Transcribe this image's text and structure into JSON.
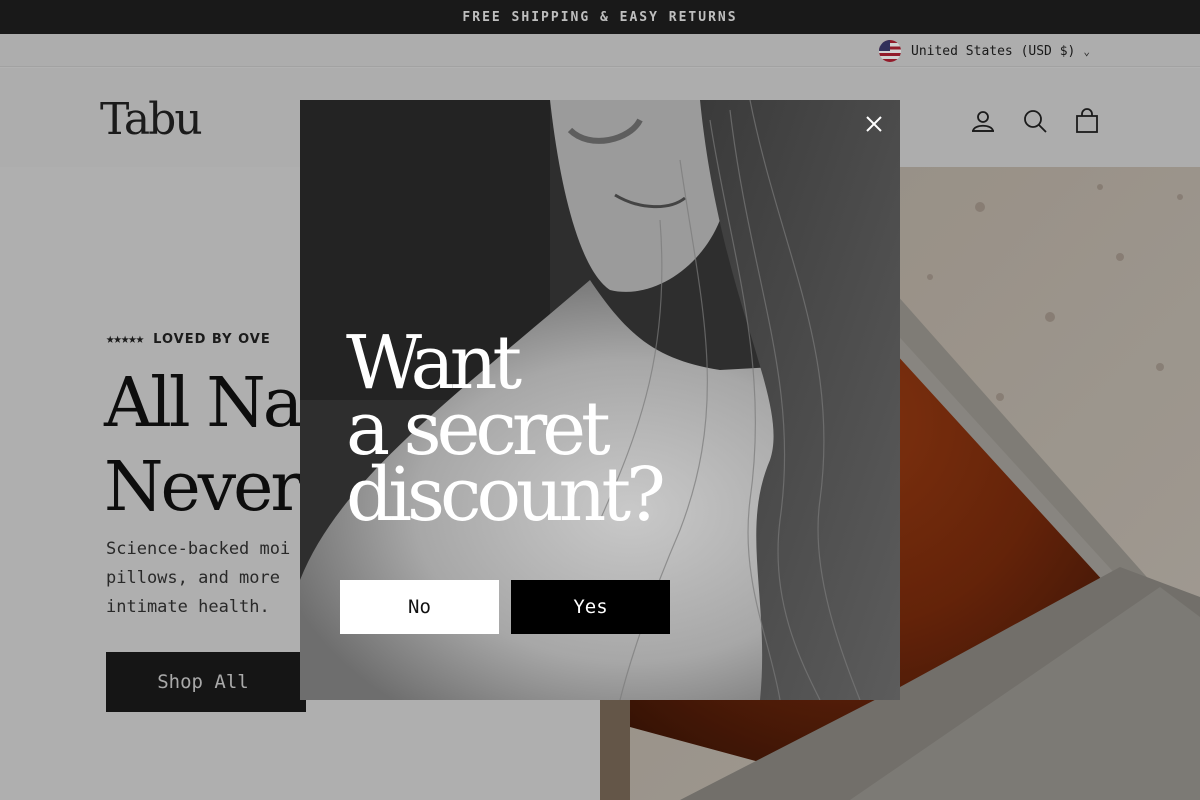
{
  "announcement": {
    "text": "FREE SHIPPING & EASY RETURNS"
  },
  "utility": {
    "locale": "United States (USD $)",
    "flag_icon": "us-flag-icon"
  },
  "header": {
    "logo": "Tabu",
    "icons": [
      "account-icon",
      "search-icon",
      "cart-icon"
    ]
  },
  "hero": {
    "stars": "★★★★★",
    "rating_label": "LOVED BY OVE",
    "headline": "All Natu\nNever C",
    "subtext": "Science-backed moi\npillows, and more \nintimate health.",
    "cta": "Shop All"
  },
  "popup": {
    "headline": "Want\na secret\ndiscount?",
    "no_label": "No",
    "yes_label": "Yes",
    "close_icon": "close-icon"
  },
  "colors": {
    "dark": "#1f1f1f",
    "light": "#d3d3d3",
    "white": "#ffffff",
    "black": "#000000",
    "orange": "#b54a1c"
  }
}
